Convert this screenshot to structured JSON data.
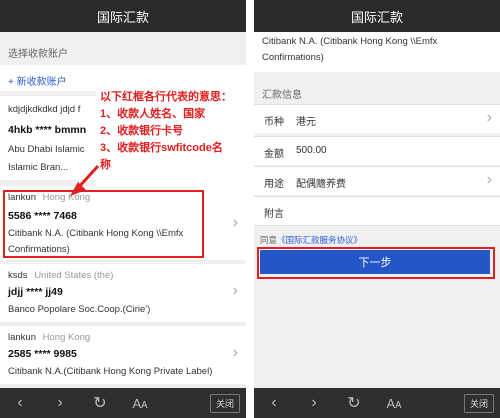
{
  "left": {
    "title": "国际汇款",
    "section_label": "选择收款账户",
    "add_account": "+ 新收款账户",
    "accounts": [
      {
        "name": "kdjdjkdkdkd jdjd f",
        "country": "",
        "card": "4hkb **** bmmn",
        "bank_line1": "Abu Dhabi Islamic",
        "bank_line2": "Islamic Bran..."
      },
      {
        "name": "lankun",
        "country": "Hong Kong",
        "card": "5586 **** 7468",
        "bank_line1": "Citibank N.A. (Citibank Hong Kong \\\\Emfx",
        "bank_line2": "Confirmations)"
      },
      {
        "name": "ksds",
        "country": "United States (the)",
        "card": "jdjj **** jj49",
        "bank_line1": "Banco Popolare Soc.Coop.(Cirie')",
        "bank_line2": ""
      },
      {
        "name": "lankun",
        "country": "Hong Kong",
        "card": "2585 **** 9985",
        "bank_line1": "Citibank N.A.(Citibank Hong Kong Private Label)",
        "bank_line2": ""
      }
    ],
    "annotation": [
      "以下红框各行代表的意思：",
      "1、收款人姓名、国家",
      "2、收款银行卡号",
      "3、收款银行swfitcode名",
      "称"
    ],
    "close_label": "关闭"
  },
  "right": {
    "title": "国际汇款",
    "bank_line1": "Citibank N.A. (Citibank Hong Kong \\\\Emfx",
    "bank_line2": "Confirmations)",
    "section_label": "汇款信息",
    "currency_key": "币种",
    "currency_val": "港元",
    "amount_key": "金额",
    "amount_val": "500.00",
    "purpose_key": "用途",
    "purpose_val": "配偶赡养费",
    "postscript_key": "附言",
    "agree_prefix": "同意",
    "agree_link": "《国际汇款服务协议》",
    "next_label": "下一步",
    "close_label": "关闭"
  },
  "colors": {
    "accent_red": "#e02020",
    "button_blue": "#2456c8",
    "link_blue": "#2a5bd7"
  }
}
